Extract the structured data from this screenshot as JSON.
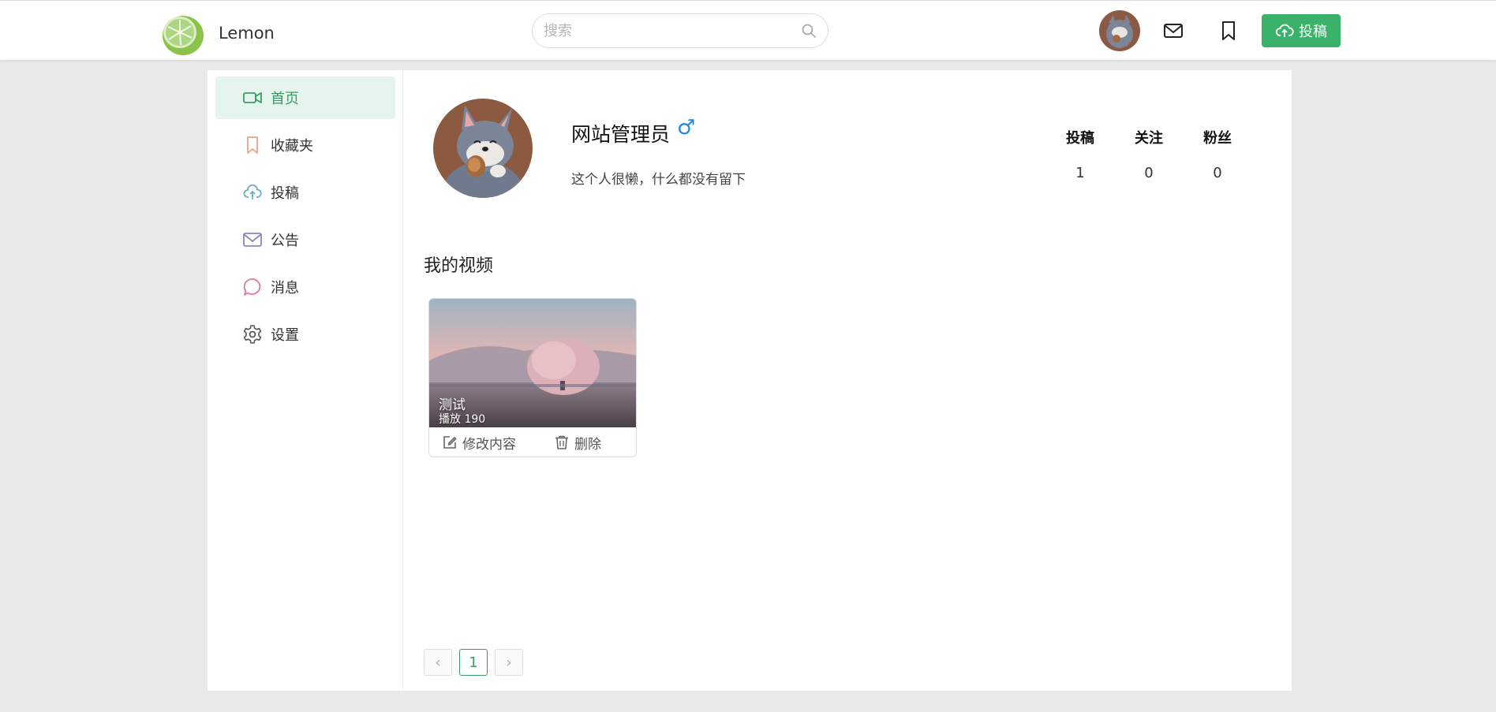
{
  "header": {
    "brand": "Lemon",
    "search_placeholder": "搜索",
    "upload_label": "投稿"
  },
  "sidebar": {
    "items": [
      {
        "label": "首页",
        "icon": "video-camera-icon",
        "active": true
      },
      {
        "label": "收藏夹",
        "icon": "bookmark-icon",
        "active": false
      },
      {
        "label": "投稿",
        "icon": "cloud-upload-icon",
        "active": false
      },
      {
        "label": "公告",
        "icon": "mail-icon",
        "active": false
      },
      {
        "label": "消息",
        "icon": "chat-bubble-icon",
        "active": false
      },
      {
        "label": "设置",
        "icon": "gear-icon",
        "active": false
      }
    ]
  },
  "profile": {
    "username": "网站管理员",
    "gender_symbol": "♂",
    "bio": "这个人很懒，什么都没有留下",
    "stats": [
      {
        "label": "投稿",
        "value": "1"
      },
      {
        "label": "关注",
        "value": "0"
      },
      {
        "label": "粉丝",
        "value": "0"
      }
    ]
  },
  "videos": {
    "section_title": "我的视频",
    "items": [
      {
        "title": "测试",
        "plays_label": "播放",
        "plays": "190",
        "edit_label": "修改内容",
        "delete_label": "删除"
      }
    ]
  },
  "pagination": {
    "current": "1",
    "prev": "‹",
    "next": "›"
  },
  "colors": {
    "accent": "#3ab26a",
    "active_bg": "#e5f4ec",
    "gender": "#1e88e5"
  }
}
